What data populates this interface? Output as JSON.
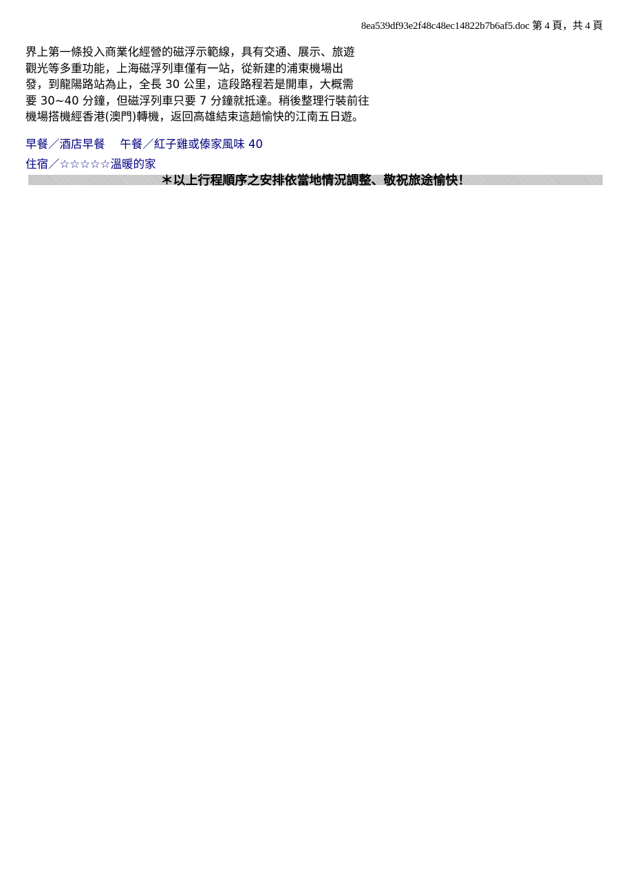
{
  "header": {
    "page_info": "8ea539df93e2f48c48ec14822b7b6af5.doc 第 4 頁，共 4 頁"
  },
  "body": {
    "lines": [
      "界上第一條投入商業化經營的磁浮示範線，具有交通、展示、旅遊",
      "觀光等多重功能，上海磁浮列車僅有一站，從新建的浦東機場出",
      "發，到龍陽路站為止，全長 30 公里，這段路程若是開車，大概需",
      "要 30~40 分鐘，但磁浮列車只要 7 分鐘就抵達。稍後整理行裝前往",
      "機場搭機經香港(澳門)轉機，返回高雄結束這趟愉快的江南五日遊。"
    ]
  },
  "meals": {
    "text": "早餐／酒店早餐　 午餐／紅子雞或傣家風味 40"
  },
  "lodging": {
    "text": "住宿／☆☆☆☆☆溫暖的家"
  },
  "notice": {
    "text": "＊以上行程順序之安排依當地情況調整、敬祝旅途愉快！"
  },
  "colors": {
    "meal_text": "#000080",
    "notice_bar": "#c8c8c8"
  }
}
